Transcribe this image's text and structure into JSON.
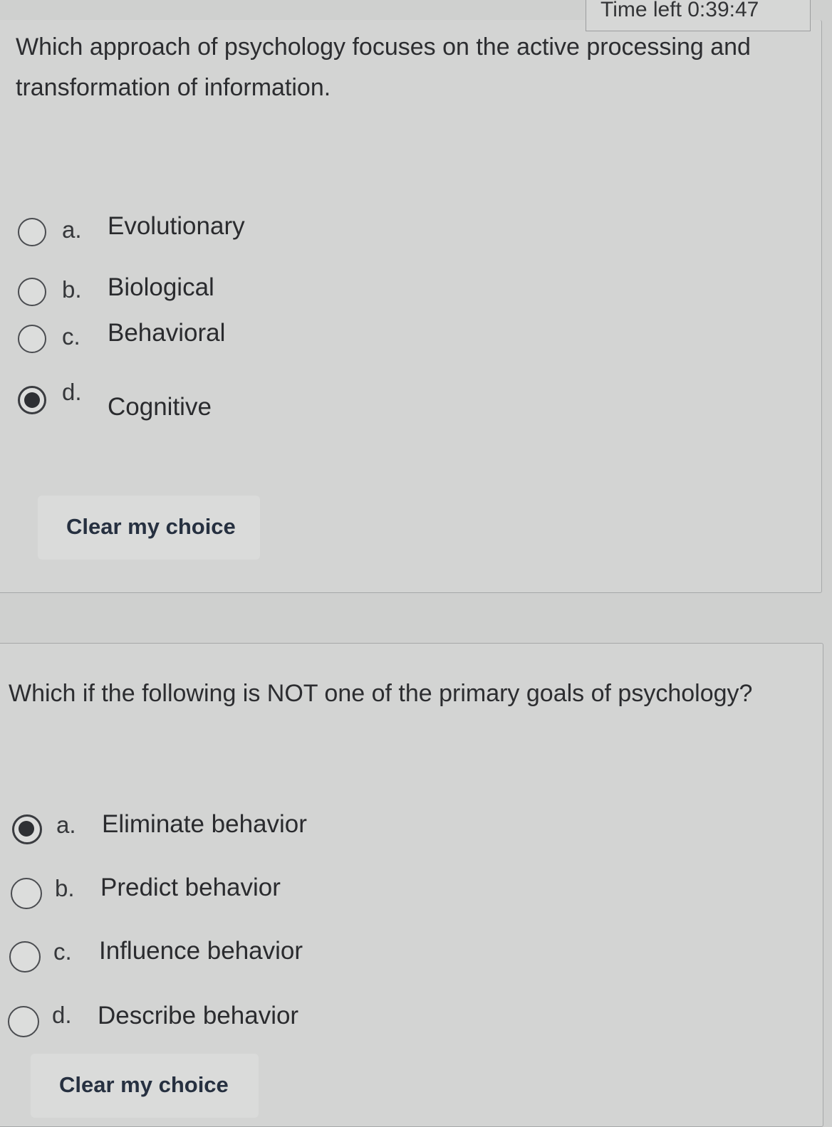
{
  "timer": {
    "label": "Time left",
    "value": "0:39:47"
  },
  "questions": [
    {
      "text": "Which approach of psychology focuses on the active processing and transformation of information.",
      "options": [
        {
          "letter": "a.",
          "label": "Evolutionary",
          "checked": false
        },
        {
          "letter": "b.",
          "label": "Biological",
          "checked": false
        },
        {
          "letter": "c.",
          "label": "Behavioral",
          "checked": false
        },
        {
          "letter": "d.",
          "label": "Cognitive",
          "checked": true
        }
      ],
      "clear_label": "Clear my choice"
    },
    {
      "text": "Which if the following is NOT one of the primary goals of psychology?",
      "options": [
        {
          "letter": "a.",
          "label": "Eliminate behavior",
          "checked": true
        },
        {
          "letter": "b.",
          "label": "Predict behavior",
          "checked": false
        },
        {
          "letter": "c.",
          "label": "Influence behavior",
          "checked": false
        },
        {
          "letter": "d.",
          "label": "Describe behavior",
          "checked": false
        }
      ],
      "clear_label": "Clear my choice"
    }
  ]
}
